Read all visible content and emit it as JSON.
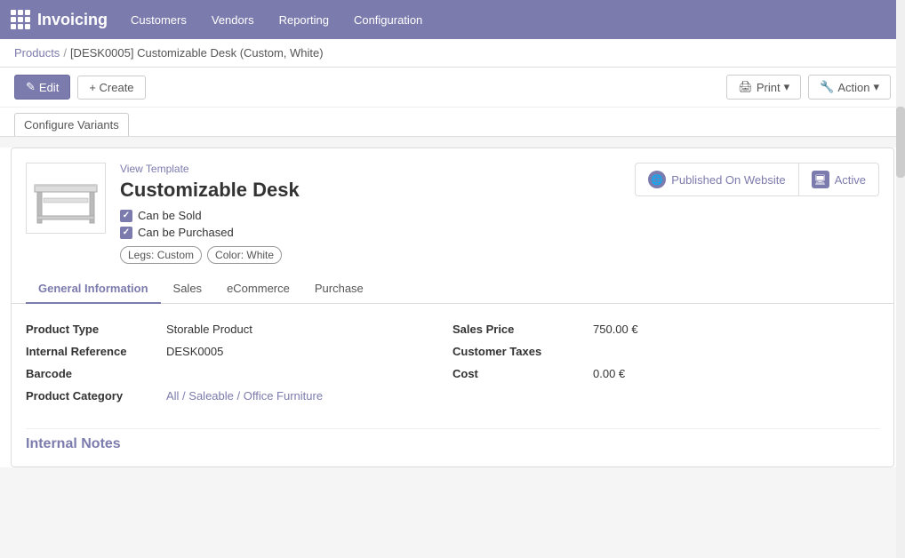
{
  "app": {
    "title": "Invoicing"
  },
  "navbar": {
    "logo": "Invoicing",
    "links": [
      {
        "label": "Customers",
        "href": "#"
      },
      {
        "label": "Vendors",
        "href": "#"
      },
      {
        "label": "Reporting",
        "href": "#"
      },
      {
        "label": "Configuration",
        "href": "#"
      }
    ]
  },
  "breadcrumb": {
    "parent_label": "Products",
    "separator": "/",
    "current": "[DESK0005] Customizable Desk (Custom, White)"
  },
  "toolbar": {
    "edit_label": "Edit",
    "create_label": "+ Create",
    "print_label": "Print",
    "action_label": "Action",
    "configure_variants_label": "Configure Variants"
  },
  "status": {
    "published_label": "Published On Website",
    "active_label": "Active"
  },
  "product": {
    "view_template_label": "View Template",
    "name": "Customizable Desk",
    "can_be_sold_label": "Can be Sold",
    "can_be_purchased_label": "Can be Purchased",
    "variants": [
      {
        "label": "Legs: Custom"
      },
      {
        "label": "Color: White"
      }
    ]
  },
  "tabs": [
    {
      "label": "General Information",
      "active": true
    },
    {
      "label": "Sales"
    },
    {
      "label": "eCommerce"
    },
    {
      "label": "Purchase"
    }
  ],
  "fields": {
    "left": [
      {
        "label": "Product Type",
        "value": "Storable Product",
        "link": false
      },
      {
        "label": "Internal Reference",
        "value": "DESK0005",
        "link": false
      },
      {
        "label": "Barcode",
        "value": "",
        "link": false
      },
      {
        "label": "Product Category",
        "value": "All / Saleable / Office Furniture",
        "link": true
      }
    ],
    "right": [
      {
        "label": "Sales Price",
        "value": "750.00 €",
        "link": false
      },
      {
        "label": "Customer Taxes",
        "value": "",
        "link": false
      },
      {
        "label": "Cost",
        "value": "0.00 €",
        "link": false
      }
    ]
  },
  "internal_notes": {
    "title": "Internal Notes"
  }
}
